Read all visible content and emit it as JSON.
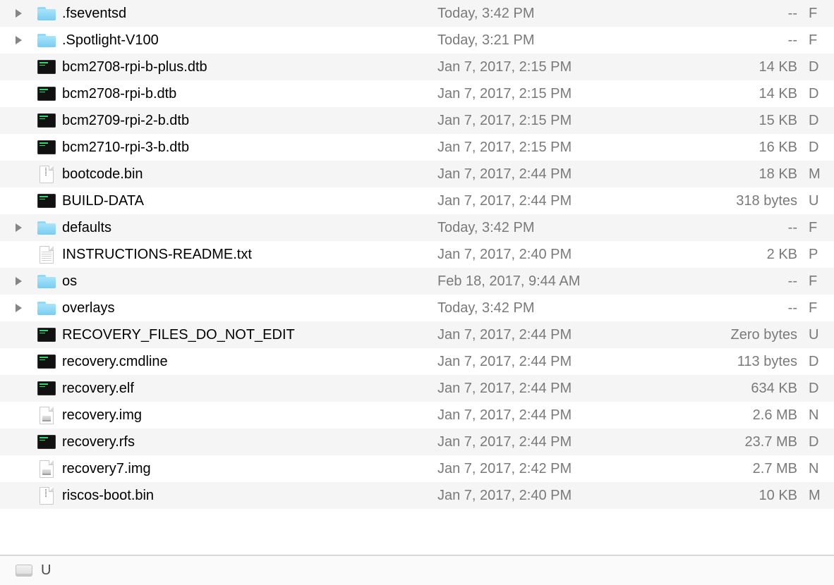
{
  "files": [
    {
      "name": ".fseventsd",
      "date": "Today, 3:42 PM",
      "size": "--",
      "kind": "F",
      "type": "folder",
      "expandable": true
    },
    {
      "name": ".Spotlight-V100",
      "date": "Today, 3:21 PM",
      "size": "--",
      "kind": "F",
      "type": "folder",
      "expandable": true
    },
    {
      "name": "bcm2708-rpi-b-plus.dtb",
      "date": "Jan 7, 2017, 2:15 PM",
      "size": "14 KB",
      "kind": "D",
      "type": "terminal",
      "expandable": false
    },
    {
      "name": "bcm2708-rpi-b.dtb",
      "date": "Jan 7, 2017, 2:15 PM",
      "size": "14 KB",
      "kind": "D",
      "type": "terminal",
      "expandable": false
    },
    {
      "name": "bcm2709-rpi-2-b.dtb",
      "date": "Jan 7, 2017, 2:15 PM",
      "size": "15 KB",
      "kind": "D",
      "type": "terminal",
      "expandable": false
    },
    {
      "name": "bcm2710-rpi-3-b.dtb",
      "date": "Jan 7, 2017, 2:15 PM",
      "size": "16 KB",
      "kind": "D",
      "type": "terminal",
      "expandable": false
    },
    {
      "name": "bootcode.bin",
      "date": "Jan 7, 2017, 2:44 PM",
      "size": "18 KB",
      "kind": "M",
      "type": "zip",
      "expandable": false
    },
    {
      "name": "BUILD-DATA",
      "date": "Jan 7, 2017, 2:44 PM",
      "size": "318 bytes",
      "kind": "U",
      "type": "terminal",
      "expandable": false
    },
    {
      "name": "defaults",
      "date": "Today, 3:42 PM",
      "size": "--",
      "kind": "F",
      "type": "folder",
      "expandable": true
    },
    {
      "name": "INSTRUCTIONS-README.txt",
      "date": "Jan 7, 2017, 2:40 PM",
      "size": "2 KB",
      "kind": "P",
      "type": "text",
      "expandable": false
    },
    {
      "name": "os",
      "date": "Feb 18, 2017, 9:44 AM",
      "size": "--",
      "kind": "F",
      "type": "folder",
      "expandable": true
    },
    {
      "name": "overlays",
      "date": "Today, 3:42 PM",
      "size": "--",
      "kind": "F",
      "type": "folder",
      "expandable": true
    },
    {
      "name": "RECOVERY_FILES_DO_NOT_EDIT",
      "date": "Jan 7, 2017, 2:44 PM",
      "size": "Zero bytes",
      "kind": "U",
      "type": "terminal",
      "expandable": false
    },
    {
      "name": "recovery.cmdline",
      "date": "Jan 7, 2017, 2:44 PM",
      "size": "113 bytes",
      "kind": "D",
      "type": "terminal",
      "expandable": false
    },
    {
      "name": "recovery.elf",
      "date": "Jan 7, 2017, 2:44 PM",
      "size": "634 KB",
      "kind": "D",
      "type": "terminal",
      "expandable": false
    },
    {
      "name": "recovery.img",
      "date": "Jan 7, 2017, 2:44 PM",
      "size": "2.6 MB",
      "kind": "N",
      "type": "disk",
      "expandable": false
    },
    {
      "name": "recovery.rfs",
      "date": "Jan 7, 2017, 2:44 PM",
      "size": "23.7 MB",
      "kind": "D",
      "type": "terminal",
      "expandable": false
    },
    {
      "name": "recovery7.img",
      "date": "Jan 7, 2017, 2:42 PM",
      "size": "2.7 MB",
      "kind": "N",
      "type": "disk",
      "expandable": false
    },
    {
      "name": "riscos-boot.bin",
      "date": "Jan 7, 2017, 2:40 PM",
      "size": "10 KB",
      "kind": "M",
      "type": "zip",
      "expandable": false
    }
  ],
  "status": {
    "volume_label": "U"
  }
}
